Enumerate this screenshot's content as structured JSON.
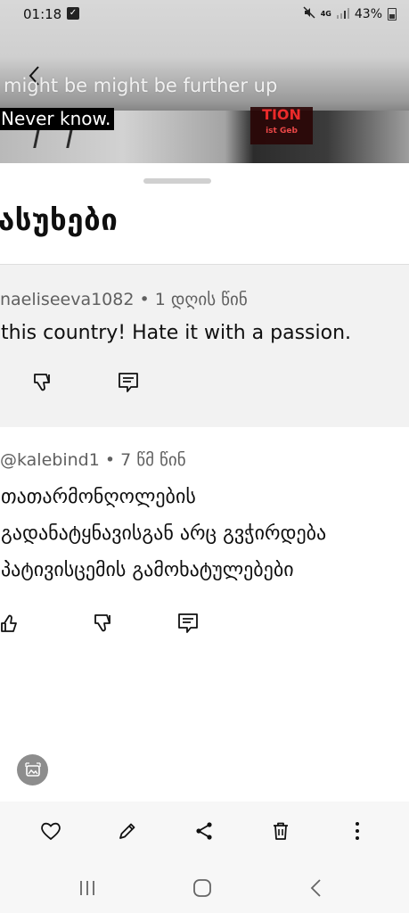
{
  "status_bar": {
    "time": "01:18",
    "network": "4G",
    "battery": "43%"
  },
  "video": {
    "caption_upper": "might be might be further up",
    "caption_lower": "Never know.",
    "sign_text": "TION",
    "sign_subtext": "ist Geb"
  },
  "sheet": {
    "title": "ასუხები",
    "replies": [
      {
        "author": "naeliseeva1082",
        "age": "1 დღის წინ",
        "text": "this country! Hate it with a passion."
      },
      {
        "author": "@kalebind1",
        "age": "7 წმ წინ",
        "lines": [
          "თათარმონღოლების",
          "გადანატყნავისგან არც გვჭირდება",
          "პატივისცემის გამოხატულებები"
        ]
      }
    ]
  },
  "toolbar": {
    "items": [
      "heart-icon",
      "edit-icon",
      "share-icon",
      "delete-icon",
      "more-icon"
    ]
  },
  "navbar": {
    "items": [
      "recent-apps-icon",
      "home-icon",
      "back-icon"
    ]
  }
}
